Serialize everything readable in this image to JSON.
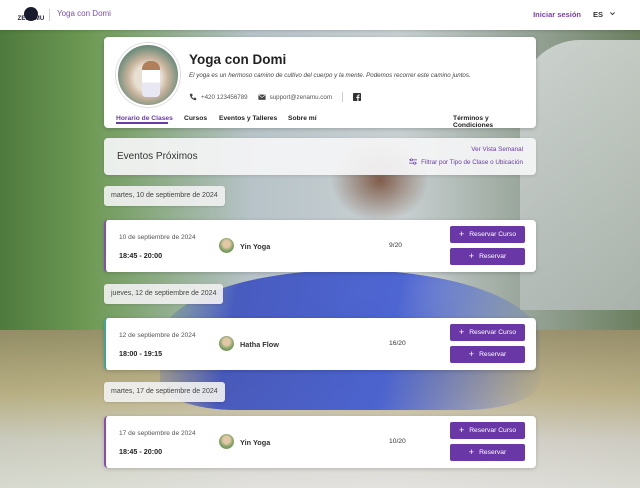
{
  "topbar": {
    "brand": "Yoga con Domi",
    "logo_text": "ZENAMU",
    "login_label": "Iniciar sesión",
    "language": "ES"
  },
  "profile": {
    "name": "Yoga con Domi",
    "description": "El yoga es un hermoso camino de cultivo del cuerpo y la mente. Podemos recorrer este camino juntos.",
    "phone": "+420 123456789",
    "email": "support@zenamu.com",
    "tabs": [
      "Horario de Clases",
      "Cursos",
      "Eventos y Talleres",
      "Sobre mí"
    ],
    "terms_label": "Términos y Condiciones"
  },
  "events_header": {
    "title": "Eventos Próximos",
    "weekly_view_label": "Ver Vista Semanal",
    "filter_label": "Filtrar por Tipo de Clase o Ubicación"
  },
  "days": [
    {
      "label": "martes, 10 de septiembre de 2024",
      "event": {
        "date": "10 de septiembre de 2024",
        "time": "18:45 - 20:00",
        "name": "Yin Yoga",
        "capacity": "9/20",
        "accent": "#8b4bb5"
      }
    },
    {
      "label": "jueves, 12 de septiembre de 2024",
      "event": {
        "date": "12 de septiembre de 2024",
        "time": "18:00 - 19:15",
        "name": "Hatha Flow",
        "capacity": "16/20",
        "accent": "#3aa898"
      }
    },
    {
      "label": "martes, 17 de septiembre de 2024",
      "event": {
        "date": "17 de septiembre de 2024",
        "time": "18:45 - 20:00",
        "name": "Yin Yoga",
        "capacity": "10/20",
        "accent": "#8b4bb5"
      }
    }
  ],
  "buttons": {
    "reserve_course": "Reservar Curso",
    "reserve": "Reservar"
  },
  "colors": {
    "primary": "#6a37a6",
    "accent_link": "#6a3aa8"
  }
}
